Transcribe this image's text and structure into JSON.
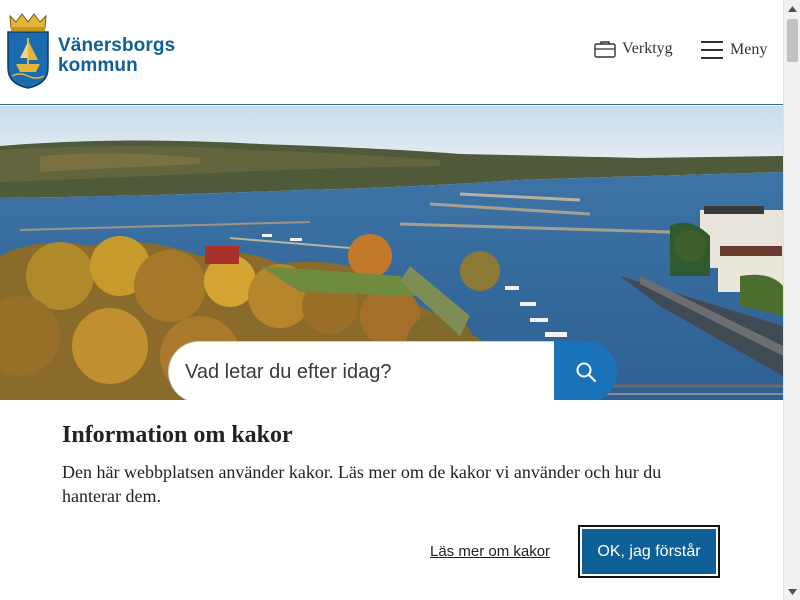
{
  "header": {
    "logo_line1": "Vänersborgs",
    "logo_line2": "kommun",
    "tools_label": "Verktyg",
    "menu_label": "Meny"
  },
  "hero": {
    "image": "harbour-lake-aerial-photo"
  },
  "search": {
    "placeholder": "Vad letar du efter idag?"
  },
  "cookie": {
    "title": "Information om kakor",
    "text": "Den här webbplatsen använder kakor. Läs mer om de kakor vi använder och hur du hanterar dem.",
    "link_label": "Läs mer om kakor",
    "ok_label": "OK, jag förstår"
  },
  "icons": {
    "tools": "briefcase-icon",
    "menu": "hamburger-icon",
    "search": "search-icon"
  },
  "colors": {
    "brand": "#0f5f98",
    "search_button": "#1a73b8",
    "header_border": "#2a6aa0"
  }
}
